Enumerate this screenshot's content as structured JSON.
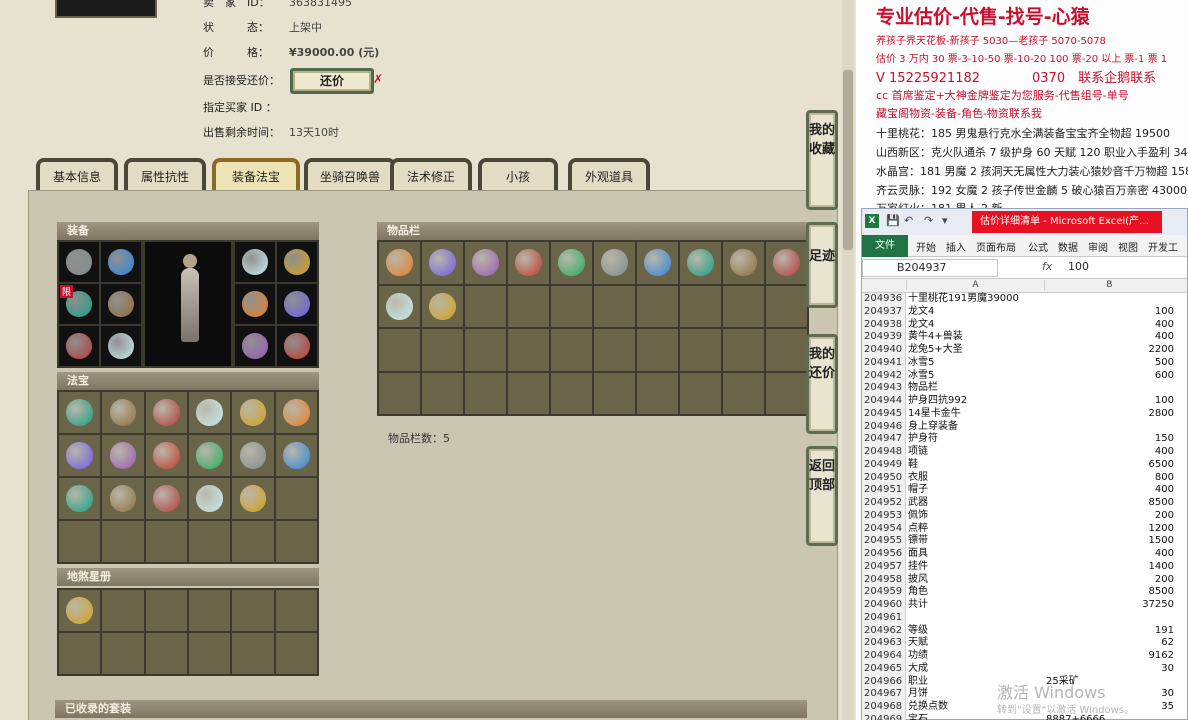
{
  "listing": {
    "seller_label": "卖　家　ID：",
    "seller_value": "363831495",
    "status_label": "状　　　态：",
    "status_value": "上架中",
    "price_label": "价　　　格：",
    "price_value": "¥39000.00 (元)",
    "counter_label": "是否接受还价：",
    "counter_button": "还价",
    "counter_x": "✗",
    "buyer_label": "指定买家 ID ：",
    "remaining_label": "出售剩余时间：",
    "remaining_value": "13天10时"
  },
  "tabs": [
    "基本信息",
    "属性抗性",
    "装备法宝",
    "坐骑召唤兽",
    "法术修正",
    "小孩",
    "外观道具"
  ],
  "active_tab": "装备法宝",
  "sections": {
    "equipment": "装备",
    "treasure": "法宝",
    "fame": "地煞星册",
    "inventory": "物品栏",
    "sets": "已收录的套装"
  },
  "equip_tag": "限",
  "inventory_count": "物品栏数：5",
  "side_buttons": {
    "favorites": "我的收藏",
    "footprint": "足迹",
    "my_offers": "我的还价",
    "back_top": "返回顶部"
  },
  "colors": {
    "accent_red": "#c8102e",
    "tab_active": "#ede3b4",
    "excel_green": "#217346"
  },
  "ad": {
    "title": "专业估价-代售-找号-心猿",
    "lines": [
      "养孩子界天花板-新孩子 5030—老孩子 5070-5078",
      "估价 3 万内 30 票-3-10-50 票-10-20 100 票-20 以上 票-1 票 1",
      "V 15225921182　　　　0370　联系企鹅联系",
      "cc 首席鉴定+大神金牌鉴定为您服务-代售组号-单号",
      "藏宝阁物资-装备-角色-物资联系我"
    ],
    "listings": [
      "十里桃花：185 男鬼悬行克水全满装备宝宝齐全物超 19500",
      "山西新区：克火队通杀 7 级护身 60 天赋 120 职业入手盈利 34500",
      "水晶宫：181 男魔 2 孩洞天无属性大力装心猿妙音千万物超 15800",
      "齐云灵脉：192 女魔 2 孩子传世金麟 5 破心猿百万亲密 43000",
      "万家灯火：181 男人 2 新"
    ]
  },
  "excel": {
    "app_letter": "X",
    "quick_access": [
      "💾",
      "↶",
      "↷",
      "▾"
    ],
    "caption": "估价详细清单 - Microsoft Excel(产…",
    "ribbon_tabs": [
      "文件",
      "开始",
      "插入",
      "页面布局",
      "公式",
      "数据",
      "审阅",
      "视图",
      "开发工具"
    ],
    "name_box": "B204937",
    "fx": "fx",
    "formula_value": "100",
    "col_a": "A",
    "col_b": "B",
    "rows": [
      {
        "n": "204936",
        "a": "十里桃花191男魔39000",
        "b": ""
      },
      {
        "n": "204937",
        "a": "龙文4",
        "b": "100"
      },
      {
        "n": "204938",
        "a": "龙文4",
        "b": "400"
      },
      {
        "n": "204939",
        "a": "黄牛4+兽装",
        "b": "400"
      },
      {
        "n": "204940",
        "a": "龙兔5+大圣",
        "b": "2200"
      },
      {
        "n": "204941",
        "a": "冰雪5",
        "b": "500"
      },
      {
        "n": "204942",
        "a": "冰雪5",
        "b": "600"
      },
      {
        "n": "204943",
        "a": "物品栏",
        "b": ""
      },
      {
        "n": "204944",
        "a": "护身四抗992",
        "b": "100"
      },
      {
        "n": "204945",
        "a": "14星卡金牛",
        "b": "2800"
      },
      {
        "n": "204946",
        "a": "身上穿装备",
        "b": ""
      },
      {
        "n": "204947",
        "a": "护身符",
        "b": "150"
      },
      {
        "n": "204948",
        "a": "项链",
        "b": "400"
      },
      {
        "n": "204949",
        "a": "鞋",
        "b": "6500"
      },
      {
        "n": "204950",
        "a": "衣服",
        "b": "800"
      },
      {
        "n": "204951",
        "a": "帽子",
        "b": "400"
      },
      {
        "n": "204952",
        "a": "武器",
        "b": "8500"
      },
      {
        "n": "204953",
        "a": "佩饰",
        "b": "200"
      },
      {
        "n": "204954",
        "a": "点粹",
        "b": "1200"
      },
      {
        "n": "204955",
        "a": "镖带",
        "b": "1500"
      },
      {
        "n": "204956",
        "a": "面具",
        "b": "400"
      },
      {
        "n": "204957",
        "a": "挂件",
        "b": "1400"
      },
      {
        "n": "204958",
        "a": "披风",
        "b": "200"
      },
      {
        "n": "204959",
        "a": "角色",
        "b": "8500"
      },
      {
        "n": "204960",
        "a": "共计",
        "b": "37250"
      },
      {
        "n": "204961",
        "a": "",
        "b": ""
      },
      {
        "n": "204962",
        "a": "等级",
        "b": "191"
      },
      {
        "n": "204963",
        "a": "天赋",
        "b": "62"
      },
      {
        "n": "204964",
        "a": "功绩",
        "b": "9162"
      },
      {
        "n": "204965",
        "a": "大成",
        "b": "30"
      },
      {
        "n": "204966",
        "a": "职业",
        "b": "25采矿",
        "left": true
      },
      {
        "n": "204967",
        "a": "月饼",
        "b": "30"
      },
      {
        "n": "204968",
        "a": "兑换点数",
        "b": "35"
      },
      {
        "n": "204969",
        "a": "宝石",
        "b": "8887+6666",
        "left": true
      }
    ],
    "watermark": "激活 Windows",
    "watermark_sub": "转到\"设置\"以激活 Windows。"
  }
}
